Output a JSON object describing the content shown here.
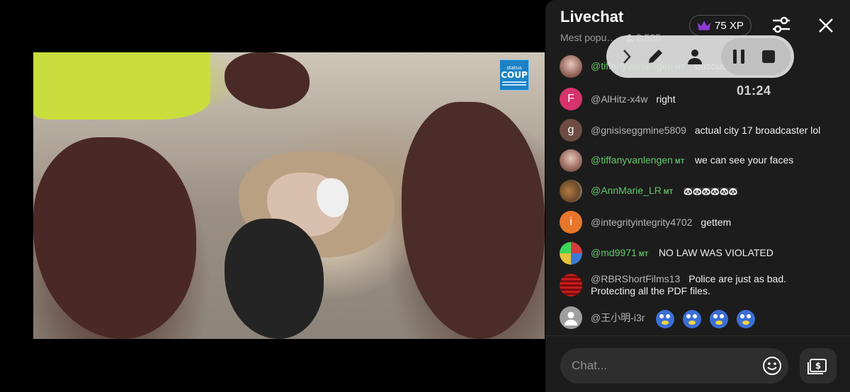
{
  "video": {
    "logo_top": "status",
    "logo_main": "COUP"
  },
  "header": {
    "title": "Livechat",
    "sort_label": "Mest popu…",
    "viewer_count": "2.535",
    "xp_label": "75 XP",
    "accent_purple": "#8e3bd6"
  },
  "recorder": {
    "timer": "01:24"
  },
  "messages": [
    {
      "username": "@tiffanyvanlengen",
      "badge": "MT",
      "text": "duscusti",
      "green": true,
      "avatar": "photo-pink"
    },
    {
      "username": "@AlHitz-x4w",
      "badge": "",
      "text": "right",
      "green": false,
      "avatar_letter": "F",
      "avatar_color": "#d6336c"
    },
    {
      "username": "@gnisiseggmine5809",
      "badge": "",
      "text": "actual city 17 broadcaster lol",
      "green": false,
      "avatar_letter": "g",
      "avatar_color": "#6d4c41"
    },
    {
      "username": "@tiffanyvanlengen",
      "badge": "MT",
      "text": "we can see your faces",
      "green": true,
      "avatar": "photo-pink"
    },
    {
      "username": "@AnnMarie_LR",
      "badge": "MT",
      "text": "🐼🐼🐼🐼🐼🐼",
      "green": true,
      "avatar": "photo-horse"
    },
    {
      "username": "@integrityintegrity4702",
      "badge": "",
      "text": "gettem",
      "green": false,
      "avatar_letter": "i",
      "avatar_color": "#e8762b"
    },
    {
      "username": "@md9971",
      "badge": "MT",
      "text": "NO LAW WAS VIOLATED",
      "green": true,
      "avatar": "photo-pills"
    },
    {
      "username": "@RBRShortFilms13",
      "badge": "",
      "text": "Police are just as bad. Protecting all the PDF files.",
      "green": false,
      "avatar": "photo-red"
    },
    {
      "username": "@王小明-i3r",
      "badge": "",
      "text": "",
      "green": false,
      "avatar": "default-person",
      "emojis": 4
    }
  ],
  "chat_input": {
    "placeholder": "Chat..."
  }
}
